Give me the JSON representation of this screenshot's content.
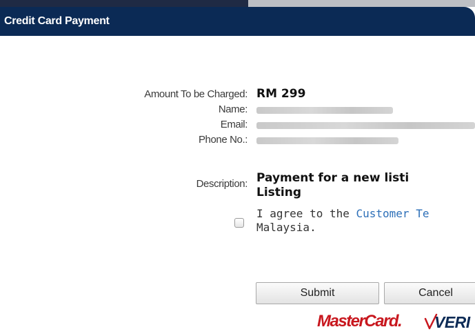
{
  "window": {
    "title": "Credit Card Payment"
  },
  "form": {
    "amount_label": "Amount To be Charged:",
    "amount_value": "RM 299",
    "name_label": "Name:",
    "email_label": "Email:",
    "phone_label": "Phone No.:",
    "description_label": "Description:",
    "description_line1": "Payment for a new listi",
    "description_line2": "Listing",
    "agree_line1_prefix": "I agree to the ",
    "agree_link": "Customer Te",
    "agree_line2": "Malaysia."
  },
  "buttons": {
    "submit": "Submit",
    "cancel": "Cancel"
  },
  "logos": {
    "mastercard": "MasterCard.",
    "verisign": "VERI"
  },
  "colors": {
    "titlebar": "#0b2a55",
    "link": "#2c6fb8",
    "mastercard": "#c8171e"
  }
}
